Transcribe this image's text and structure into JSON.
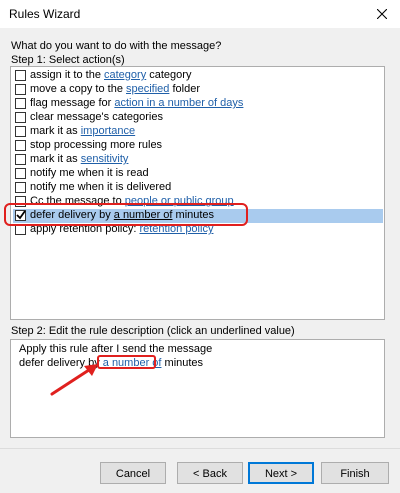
{
  "window": {
    "title": "Rules Wizard"
  },
  "prompt": "What do you want to do with the message?",
  "step1": {
    "label": "Step 1: Select action(s)",
    "actions": [
      {
        "pre": "assign it to the ",
        "link": "category",
        "post": " category",
        "checked": false
      },
      {
        "pre": "move a copy to the ",
        "link": "specified",
        "post": " folder",
        "checked": false
      },
      {
        "pre": "flag message for ",
        "link": "action in a number of days",
        "post": "",
        "checked": false
      },
      {
        "pre": "clear message's categories",
        "link": "",
        "post": "",
        "checked": false
      },
      {
        "pre": "mark it as ",
        "link": "importance",
        "post": "",
        "checked": false
      },
      {
        "pre": "stop processing more rules",
        "link": "",
        "post": "",
        "checked": false
      },
      {
        "pre": "mark it as ",
        "link": "sensitivity",
        "post": "",
        "checked": false
      },
      {
        "pre": "notify me when it is read",
        "link": "",
        "post": "",
        "checked": false
      },
      {
        "pre": "notify me when it is delivered",
        "link": "",
        "post": "",
        "checked": false
      },
      {
        "pre": "Cc the message to ",
        "link": "people or public group",
        "post": "",
        "checked": false
      },
      {
        "pre": "defer delivery by ",
        "link": "a number of",
        "post": " minutes",
        "checked": true
      },
      {
        "pre": "apply retention policy: ",
        "link": "retention policy",
        "post": "",
        "checked": false
      }
    ]
  },
  "step2": {
    "label": "Step 2: Edit the rule description (click an underlined value)",
    "line1": "Apply this rule after I send the message",
    "line2_pre": "defer delivery by ",
    "line2_link": "a number of",
    "line2_post": " minutes"
  },
  "buttons": {
    "cancel": "Cancel",
    "back": "< Back",
    "next": "Next >",
    "finish": "Finish"
  },
  "colors": {
    "selection": "#a9cbee",
    "link": "#1f5fa8",
    "annotation": "#e0201e",
    "default_button_border": "#0078d7"
  }
}
